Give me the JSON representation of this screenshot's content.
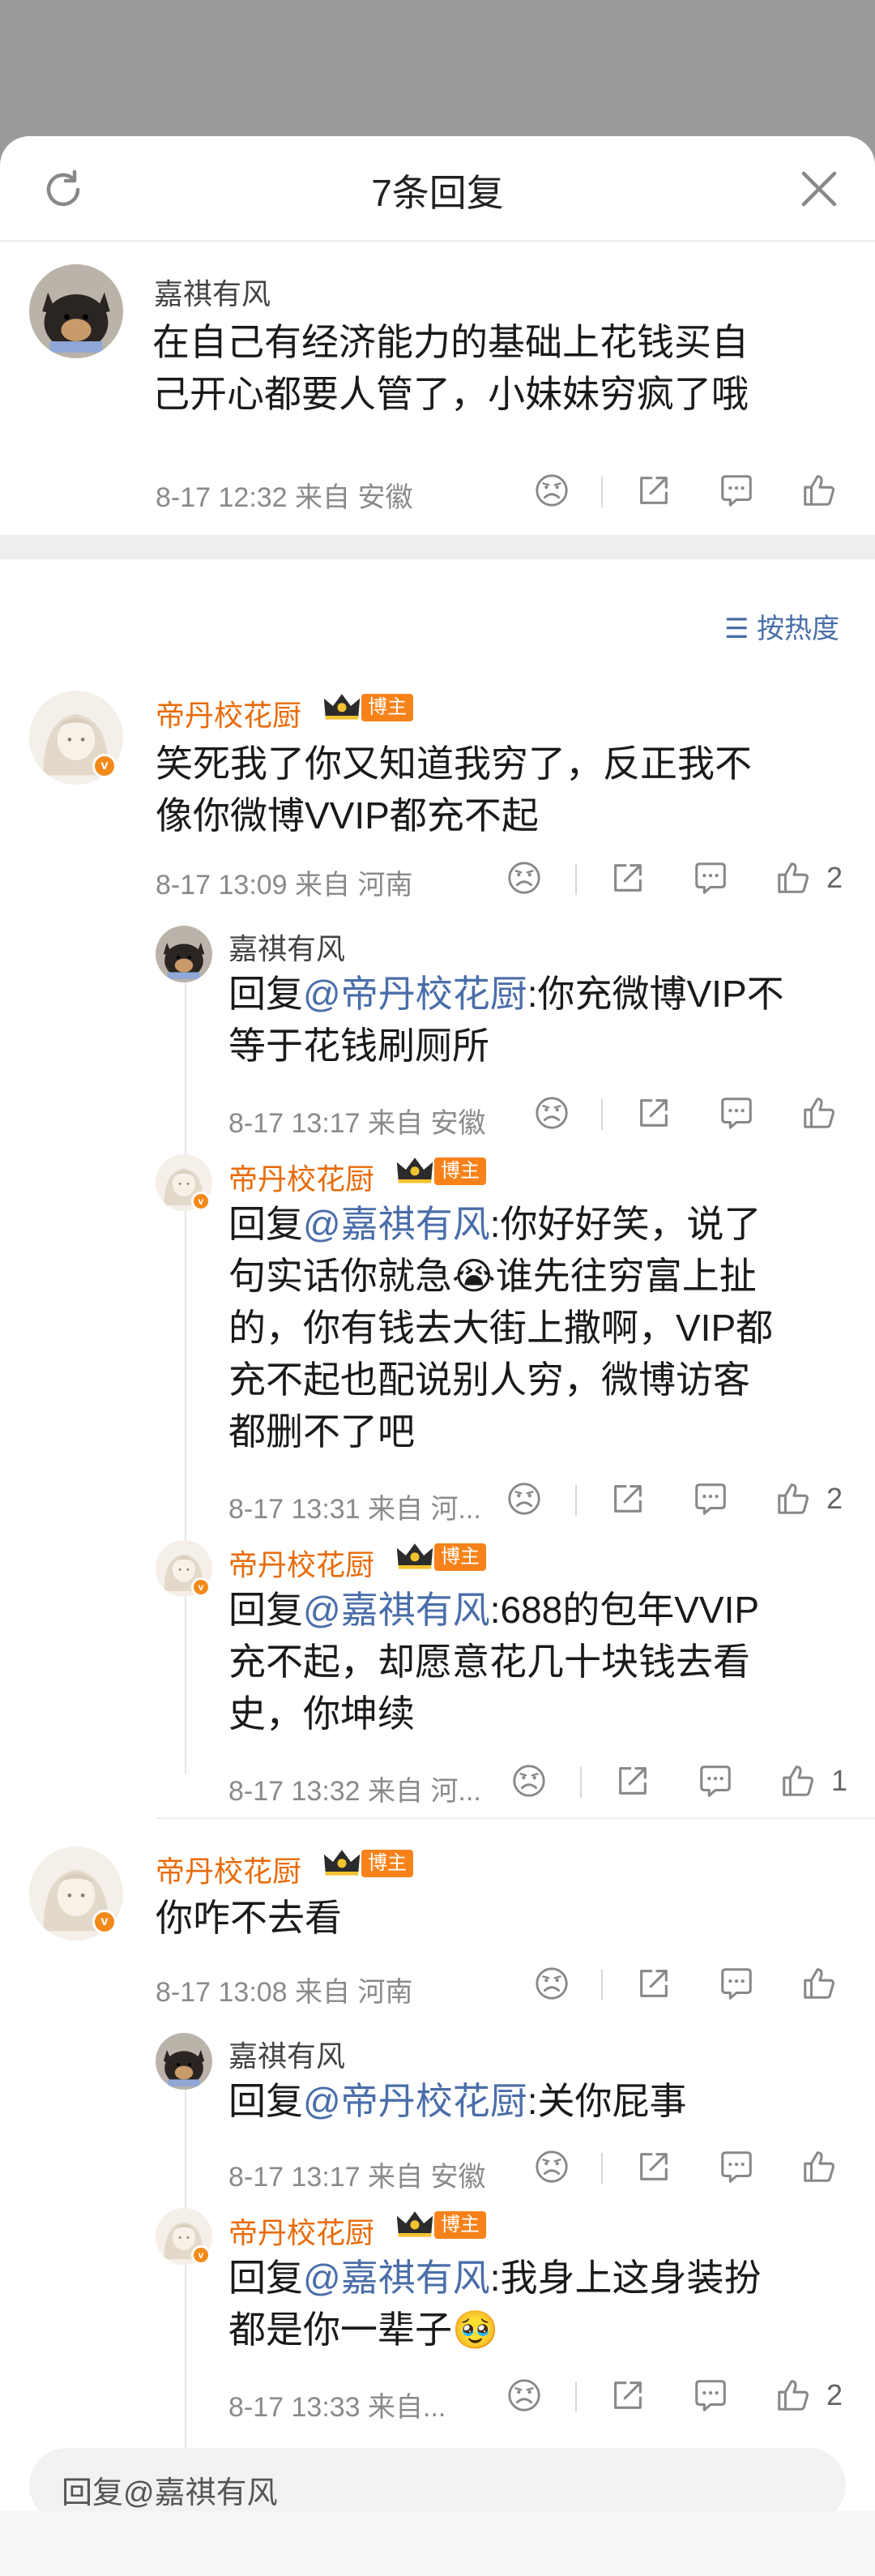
{
  "header": {
    "title": "7条回复"
  },
  "root": {
    "name": "嘉祺有风",
    "text_line1": "在自己有经济能力的基础上花钱买自",
    "text_line2": "己开心都要人管了，小妹妹穷疯了哦",
    "meta": "8-17 12:32  来自 安徽"
  },
  "sort_label": "按热度",
  "comments": [
    {
      "name": "帝丹校花厨",
      "badge": "博主",
      "line1": "笑死我了你又知道我穷了，反正我不",
      "line2": "像你微博VVIP都充不起",
      "meta": "8-17 13:09  来自 河南",
      "likes": "2",
      "replies": [
        {
          "name": "嘉祺有风",
          "prefix": "回复",
          "at": "@帝丹校花厨",
          "line1": ":你充微博VIP不",
          "line2": "等于花钱刷厕所",
          "meta": "8-17 13:17  来自 安徽",
          "likes": ""
        },
        {
          "name": "帝丹校花厨",
          "badge": "博主",
          "prefix": "回复",
          "at": "@嘉祺有风",
          "line1": ":你好好笑，说了",
          "line2": "句实话你就急😭谁先往穷富上扯",
          "line3": "的，你有钱去大街上撒啊，VIP都",
          "line4": "充不起也配说别人穷，微博访客",
          "line5": "都删不了吧",
          "meta": "8-17 13:31  来自 河...",
          "likes": "2"
        },
        {
          "name": "帝丹校花厨",
          "badge": "博主",
          "prefix": "回复",
          "at": "@嘉祺有风",
          "line1": ":688的包年VVIP",
          "line2": "充不起，却愿意花几十块钱去看",
          "line3": "史，你坤续",
          "meta": "8-17 13:32  来自 河...",
          "likes": "1"
        }
      ]
    },
    {
      "name": "帝丹校花厨",
      "badge": "博主",
      "line1": "你咋不去看",
      "meta": "8-17 13:08  来自 河南",
      "likes": "",
      "replies": [
        {
          "name": "嘉祺有风",
          "prefix": "回复",
          "at": "@帝丹校花厨",
          "line1": ":关你屁事",
          "meta": "8-17 13:17  来自 安徽",
          "likes": ""
        },
        {
          "name": "帝丹校花厨",
          "badge": "博主",
          "prefix": "回复",
          "at": "@嘉祺有风",
          "line1": ":我身上这身装扮",
          "line2": "都是你一辈子🥹",
          "meta": "8-17 13:33  来自...",
          "likes": "2"
        }
      ]
    }
  ],
  "input": {
    "placeholder": "回复@嘉祺有风"
  },
  "icons": [
    "refresh-icon",
    "close-icon",
    "dislike-icon",
    "share-icon",
    "comment-icon",
    "like-icon",
    "crown-icon",
    "sort-icon"
  ]
}
